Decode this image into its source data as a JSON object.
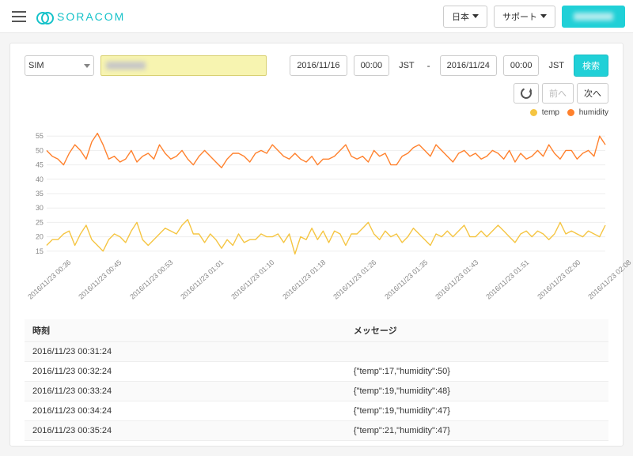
{
  "colors": {
    "temp": "#f5c542",
    "humidity": "#ff812d",
    "brand": "#20d0d7"
  },
  "header": {
    "brand": "SORACOM",
    "locale_label": "日本",
    "support_label": "サポート"
  },
  "controls": {
    "selector_label": "SIM",
    "date_from": "2016/11/16",
    "time_from": "00:00",
    "tz_from": "JST",
    "sep": "-",
    "date_to": "2016/11/24",
    "time_to": "00:00",
    "tz_to": "JST",
    "search_label": "検索",
    "prev_label": "前へ",
    "next_label": "次へ"
  },
  "legend": {
    "temp": "temp",
    "humidity": "humidity"
  },
  "table": {
    "col_time": "時刻",
    "col_msg": "メッセージ",
    "rows": [
      {
        "time": "2016/11/23 00:31:24",
        "msg": ""
      },
      {
        "time": "2016/11/23 00:32:24",
        "msg": "{\"temp\":17,\"humidity\":50}"
      },
      {
        "time": "2016/11/23 00:33:24",
        "msg": "{\"temp\":19,\"humidity\":48}"
      },
      {
        "time": "2016/11/23 00:34:24",
        "msg": "{\"temp\":19,\"humidity\":47}"
      },
      {
        "time": "2016/11/23 00:35:24",
        "msg": "{\"temp\":21,\"humidity\":47}"
      }
    ]
  },
  "chart_data": {
    "type": "line",
    "ylabel": "",
    "ylim": [
      10,
      60
    ],
    "yticks": [
      15,
      20,
      25,
      30,
      35,
      40,
      45,
      50,
      55
    ],
    "x": [
      "2016/11/23 00:36",
      "2016/11/23 00:45",
      "2016/11/23 00:53",
      "2016/11/23 01:01",
      "2016/11/23 01:10",
      "2016/11/23 01:18",
      "2016/11/23 01:26",
      "2016/11/23 01:35",
      "2016/11/23 01:43",
      "2016/11/23 01:51",
      "2016/11/23 02:00",
      "2016/11/23 02:08"
    ],
    "series": [
      {
        "name": "humidity",
        "color": "#ff812d",
        "values": [
          50,
          48,
          47,
          45,
          49,
          52,
          50,
          47,
          53,
          56,
          52,
          47,
          48,
          46,
          47,
          50,
          46,
          48,
          49,
          47,
          52,
          49,
          47,
          48,
          50,
          47,
          45,
          48,
          50,
          48,
          46,
          44,
          47,
          49,
          49,
          48,
          46,
          49,
          50,
          49,
          52,
          50,
          48,
          47,
          49,
          47,
          46,
          48,
          45,
          47,
          47,
          48,
          50,
          52,
          48,
          47,
          48,
          46,
          50,
          48,
          49,
          45,
          45,
          48,
          49,
          51,
          52,
          50,
          48,
          52,
          50,
          48,
          46,
          49,
          50,
          48,
          49,
          47,
          48,
          50,
          49,
          47,
          50,
          46,
          49,
          47,
          48,
          50,
          48,
          52,
          49,
          47,
          50,
          50,
          47,
          49,
          50,
          48,
          55,
          52
        ]
      },
      {
        "name": "temp",
        "color": "#f5c542",
        "values": [
          17,
          19,
          19,
          21,
          22,
          17,
          21,
          24,
          19,
          17,
          15,
          19,
          21,
          20,
          18,
          22,
          25,
          19,
          17,
          19,
          21,
          23,
          22,
          21,
          24,
          26,
          21,
          21,
          18,
          21,
          19,
          16,
          19,
          17,
          21,
          18,
          19,
          19,
          21,
          20,
          20,
          21,
          18,
          21,
          14,
          20,
          19,
          23,
          19,
          22,
          18,
          22,
          21,
          17,
          21,
          21,
          23,
          25,
          21,
          19,
          22,
          20,
          21,
          18,
          20,
          23,
          21,
          19,
          17,
          21,
          20,
          22,
          20,
          22,
          24,
          20,
          20,
          22,
          20,
          22,
          24,
          22,
          20,
          18,
          21,
          22,
          20,
          22,
          21,
          19,
          21,
          25,
          21,
          22,
          21,
          20,
          22,
          21,
          20,
          24
        ]
      }
    ]
  }
}
